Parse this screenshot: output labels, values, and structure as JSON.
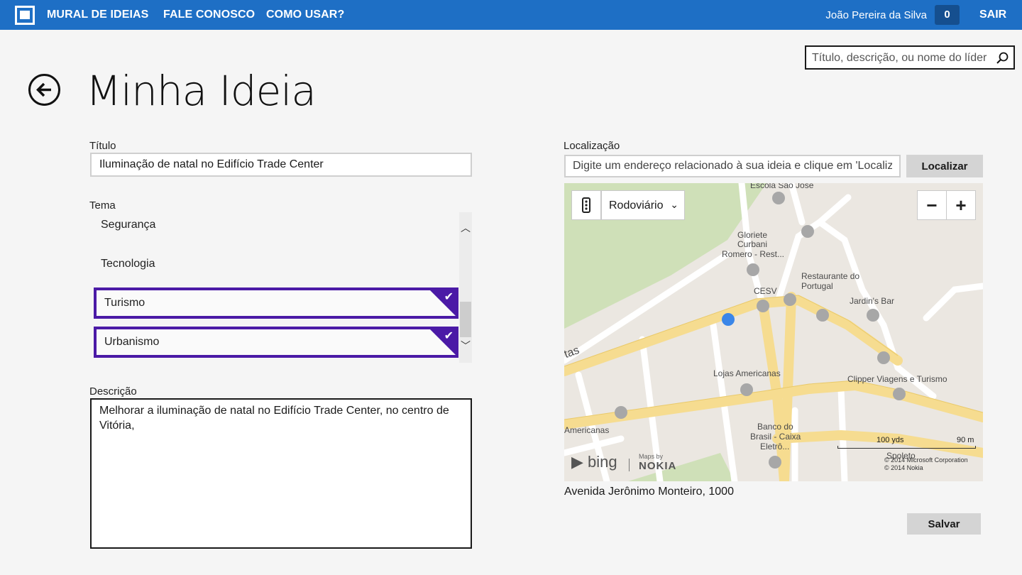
{
  "nav": {
    "links": [
      "MURAL DE IDEIAS",
      "FALE CONOSCO",
      "COMO USAR?"
    ],
    "user_name": "João Pereira da Silva",
    "notification_count": "0",
    "logout_label": "SAIR"
  },
  "search": {
    "placeholder": "Título, descrição, ou nome do líder",
    "icon": "search-icon"
  },
  "page": {
    "title": "Minha Ideia",
    "back_icon": "back-arrow-icon"
  },
  "form": {
    "titulo_label": "Título",
    "titulo_value": "Iluminação de natal no Edifício Trade Center",
    "tema_label": "Tema",
    "tema_items": [
      {
        "label": "Segurança",
        "selected": false
      },
      {
        "label": "Tecnologia",
        "selected": false
      },
      {
        "label": "Turismo",
        "selected": true
      },
      {
        "label": "Urbanismo",
        "selected": true
      }
    ],
    "descricao_label": "Descrição",
    "descricao_value": "Melhorar a iluminação de natal no Edifício Trade Center, no centro de Vitória,",
    "localizacao_label": "Localização",
    "localizacao_placeholder": "Digite um endereço relacionado à sua ideia e clique em 'Localizar'",
    "localizar_label": "Localizar",
    "address": "Avenida Jerônimo Monteiro, 1000",
    "salvar_label": "Salvar"
  },
  "map": {
    "style": "Rodoviário",
    "zoom_out": "−",
    "zoom_in": "+",
    "labels": {
      "escola": "Escola São José",
      "gloriete": "Gloriete",
      "curbani": "Curbani",
      "romero": "Romero - Rest...",
      "restaurante": "Restaurante do",
      "portugal": "Portugal",
      "cesv": "CESV",
      "jardins": "Jardin's Bar",
      "lojas": "Lojas Americanas",
      "clipper": "Clipper Viagens e Turismo",
      "americanas": "Americanas",
      "banco1": "Banco do",
      "banco2": "Brasil - Caixa",
      "banco3": "Eletrô...",
      "street_frag": "tas",
      "spoleto": "Spoleto"
    },
    "scale_yds": "100 yds",
    "scale_m": "90 m",
    "copyright_1": "© 2014 Microsoft Corporation",
    "copyright_2": "© 2014 Nokia",
    "bing": "bing",
    "maps_by": "Maps by",
    "nokia": "NOKIA",
    "accent_color": "#4b1aa6",
    "topbar_color": "#1e6fc5"
  }
}
